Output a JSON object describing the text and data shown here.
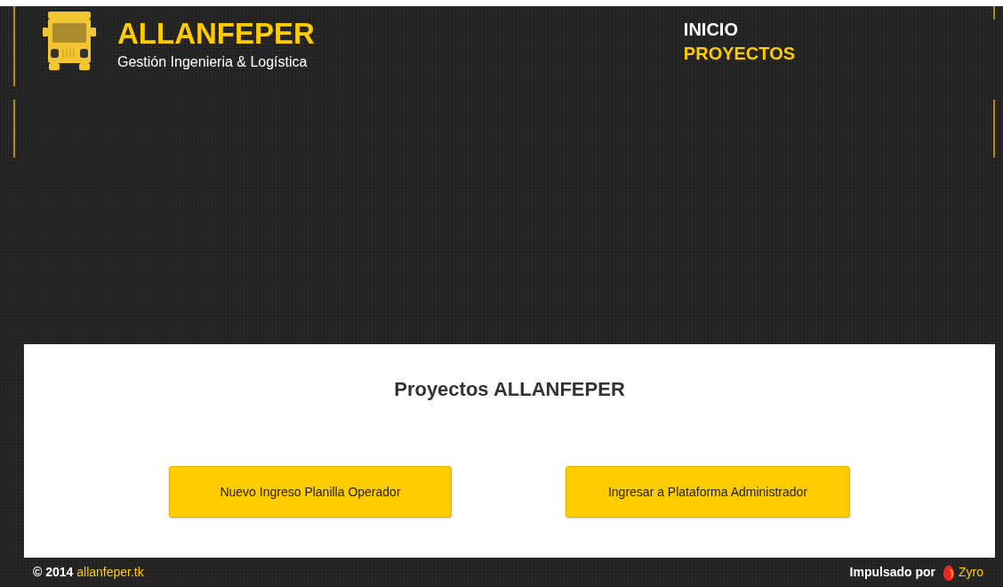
{
  "brand": {
    "title": "ALLANFEPER",
    "subtitle": "Gestión Ingenieria & Logística"
  },
  "nav": [
    {
      "label": "INICIO",
      "selected": false
    },
    {
      "label": "PROYECTOS",
      "selected": true
    }
  ],
  "content": {
    "heading": "Proyectos ALLANFEPER",
    "buttons": [
      "Nuevo Ingreso Planilla Operador",
      "Ingresar a Plataforma Administrador"
    ]
  },
  "footer": {
    "copyright": "© 2014",
    "site_link": "allanfeper.tk",
    "powered_by": "Impulsado por",
    "provider": "Zyro"
  }
}
